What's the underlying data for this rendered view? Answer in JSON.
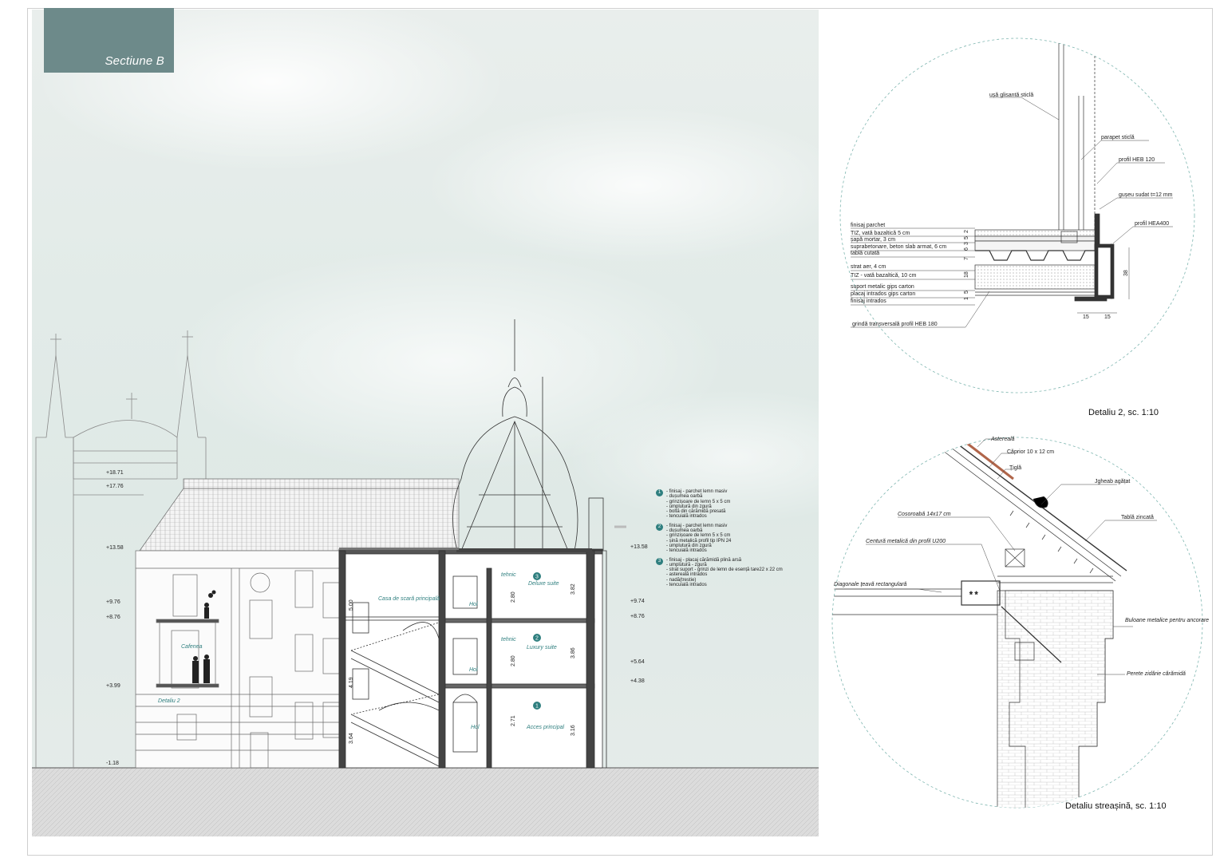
{
  "sheet": {
    "title": "Sectiune B"
  },
  "section": {
    "levels": [
      "+18.71",
      "+17.76",
      "+13.58",
      "+9.76",
      "+8.76",
      "+3.99",
      "-1.18"
    ],
    "levels_right": [
      "+13.58",
      "+9.74",
      "+8.76",
      "+5.64",
      "+4.38"
    ],
    "rooms": [
      "Casa de scară principală",
      "Deluxe suite",
      "Hol",
      "Luxury suite",
      "Hol",
      "Hol",
      "Acces principal",
      "Cafenea",
      "Detaliu 2"
    ],
    "room_markers": [
      "3",
      "2",
      "1"
    ],
    "dims": [
      "5.00",
      "4.19",
      "3.64",
      "2.80",
      "2.80",
      "2.71",
      "3.82",
      "3.86",
      "3.16"
    ],
    "small_labels": [
      "tehnic",
      "tehnic"
    ]
  },
  "legend": [
    {
      "num": "1",
      "lines": [
        "- finisaj - parchet lemn masiv",
        "- dușumea oarbă",
        "- grinzișoare de lemn 5 x 5 cm",
        "- umplutură din zgură",
        "- boltă din cărămidă presată",
        "- tencuială intrados"
      ]
    },
    {
      "num": "2",
      "lines": [
        "- finisaj - parchet lemn masiv",
        "- dușumea oarbă",
        "- grinzișoare de lemn 5 x 5 cm",
        "- șină metalică profil tip IPN 24",
        "- umplutură din zgură",
        "- tencuială intrados"
      ]
    },
    {
      "num": "3",
      "lines": [
        "- finisaj - placaj cărămidă plină arsă",
        "- umplutură - zgură",
        "- strat suport - grinzi de lemn de esență tare22 x 22 cm",
        "- asterealã intrados",
        "- nadă(trestie)",
        "- tencuială intrados"
      ]
    }
  ],
  "detail2": {
    "caption": "Detaliu 2, sc. 1:10",
    "labels": {
      "door": "ușă glisantă sticlă",
      "parapet": "parapet sticlă",
      "heb120": "profil HEB 120",
      "gusset": "gușeu sudat t=12 mm",
      "hea400": "profil HEA400",
      "beam": "grindă transversală profil HEB 180"
    },
    "layers": [
      "finisaj parchet",
      "TIZ, vată bazaltică 5 cm",
      "șapă mortar, 3 cm",
      "suprabetonare, beton slab armat, 6 cm",
      "tablă cutată",
      "strat aer, 4 cm",
      "TIZ - vată bazaltică, 10 cm",
      "suport metalic gips carton",
      "placaj intrados gips carton",
      "finisaj intrados"
    ],
    "layer_dims": [
      "2",
      "5",
      "3",
      "6",
      "7",
      "18",
      "5",
      "1"
    ],
    "dim_total": "38",
    "dim_bottom": [
      "15",
      "15"
    ]
  },
  "detail_eaves": {
    "caption": "Detaliu streașină, sc. 1:10",
    "labels": {
      "asterela": "Astereală",
      "caprior": "Căprior 10 x 12 cm",
      "tigla": "Țiglă",
      "jgheab": "Jgheab agățat",
      "tabla": "Tablă zincată",
      "cosoroaba": "Cosoroabă 14x17 cm",
      "centura": "Centură metalică din profil U200",
      "diagonale": "Diagonale țeavă rectangulară",
      "buloane": "Buloane metalice pentru ancorare",
      "perete": "Perete zidărie cărămidă"
    }
  },
  "colors": {
    "title_bg": "#6d8a8a",
    "teal": "#2f7f7f",
    "circle": "#7fb6b0",
    "ground": "#d9d9d9"
  }
}
